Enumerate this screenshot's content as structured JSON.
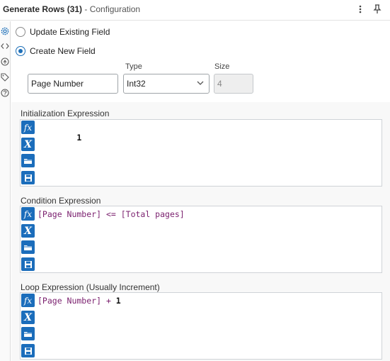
{
  "header": {
    "tool_name": "Generate Rows (31)",
    "subtitle": "- Configuration",
    "menu_icon": "more-vertical-icon",
    "pin_icon": "pin-icon"
  },
  "rail": {
    "icons": [
      "gear-icon",
      "code-icon",
      "arrows-icon",
      "tag-icon",
      "help-icon"
    ]
  },
  "options": {
    "update_label": "Update Existing Field",
    "create_label": "Create New  Field",
    "selected": "create"
  },
  "field": {
    "name_value": "Page Number",
    "type_label": "Type",
    "type_value": "Int32",
    "size_label": "Size",
    "size_value": "4"
  },
  "expressions": {
    "init": {
      "label": "Initialization Expression",
      "code": [
        {
          "t": "1",
          "c": "num"
        }
      ]
    },
    "condition": {
      "label": "Condition Expression",
      "code": [
        {
          "t": "[Page Number]",
          "c": "f"
        },
        {
          "t": " <= ",
          "c": "op"
        },
        {
          "t": "[Total pages]",
          "c": "f"
        }
      ]
    },
    "loop": {
      "label": "Loop Expression (Usually Increment)",
      "code": [
        {
          "t": "[Page Number]",
          "c": "f"
        },
        {
          "t": " + ",
          "c": "op"
        },
        {
          "t": "1",
          "c": "num"
        }
      ]
    }
  },
  "colors": {
    "accent": "#1b6dbb",
    "field_token": "#7a1f6e"
  }
}
